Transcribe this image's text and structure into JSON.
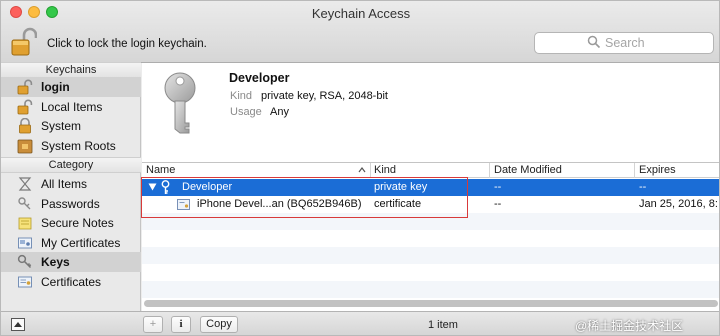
{
  "window": {
    "title": "Keychain Access"
  },
  "toolbar": {
    "lock_text": "Click to lock the login keychain.",
    "search_placeholder": "Search"
  },
  "sidebar": {
    "keychains_header": "Keychains",
    "keychains": [
      {
        "label": "login",
        "icon": "lock-open-icon",
        "selected": true
      },
      {
        "label": "Local Items",
        "icon": "lock-open-icon"
      },
      {
        "label": "System",
        "icon": "lock-icon"
      },
      {
        "label": "System Roots",
        "icon": "cabinet-lock-icon"
      }
    ],
    "category_header": "Category",
    "categories": [
      {
        "label": "All Items",
        "icon": "all-items-icon"
      },
      {
        "label": "Passwords",
        "icon": "passwords-icon"
      },
      {
        "label": "Secure Notes",
        "icon": "secure-notes-icon"
      },
      {
        "label": "My Certificates",
        "icon": "my-certificates-icon"
      },
      {
        "label": "Keys",
        "icon": "key-icon",
        "selected": true
      },
      {
        "label": "Certificates",
        "icon": "certificate-icon"
      }
    ]
  },
  "detail": {
    "name": "Developer",
    "kind_label": "Kind",
    "kind_value": "private key, RSA, 2048-bit",
    "usage_label": "Usage",
    "usage_value": "Any"
  },
  "table": {
    "columns": [
      "Name",
      "Kind",
      "Date Modified",
      "Expires"
    ],
    "rows": [
      {
        "name": "Developer",
        "kind": "private key",
        "date_modified": "--",
        "expires": "--",
        "selected": true
      },
      {
        "name": "iPhone Devel...an (BQ652B946B)",
        "kind": "certificate",
        "date_modified": "--",
        "expires": "Jan 25, 2016, 8:"
      }
    ]
  },
  "bottom": {
    "add_label": "+",
    "info_label": "i",
    "copy_label": "Copy",
    "count": "1 item"
  },
  "watermark": "@稀土掘金技术社区",
  "colors": {
    "selection": "#1b6dd6",
    "highlight_box": "#d83a3a"
  }
}
